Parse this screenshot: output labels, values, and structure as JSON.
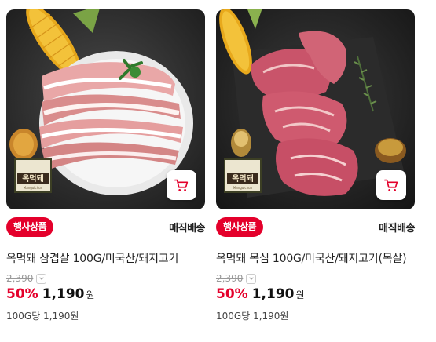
{
  "products": [
    {
      "badge": "행사상품",
      "delivery": "매직배송",
      "title": "옥먹돼 삼겹살 100G/미국산/돼지고기",
      "original_price": "2,390",
      "discount_rate": "50%",
      "price": "1,190",
      "currency": "원",
      "unit_price": "100G당 1,190원",
      "brand_label": "옥먹돼",
      "brand_sub": "Manguichun"
    },
    {
      "badge": "행사상품",
      "delivery": "매직배송",
      "title": "옥먹돼 목심 100G/미국산/돼지고기(목살)",
      "original_price": "2,390",
      "discount_rate": "50%",
      "price": "1,190",
      "currency": "원",
      "unit_price": "100G당 1,190원",
      "brand_label": "옥먹돼",
      "brand_sub": "Manguichun"
    }
  ],
  "colors": {
    "accent": "#e4002b",
    "text": "#222222",
    "muted": "#999999"
  }
}
